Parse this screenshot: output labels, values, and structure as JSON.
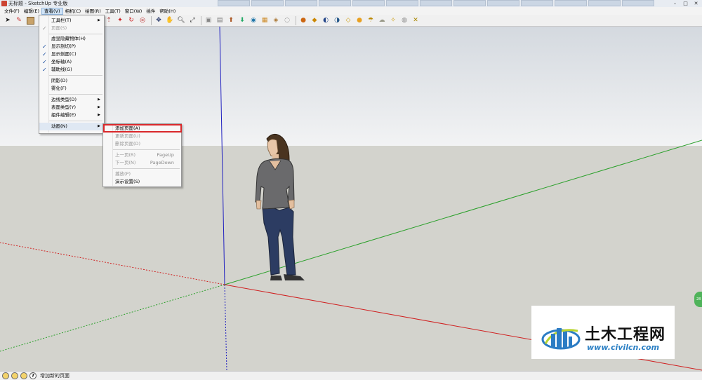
{
  "window": {
    "title": "无标题 - SketchUp 专业版"
  },
  "menubar": {
    "items": [
      {
        "label": "文件(F)"
      },
      {
        "label": "编辑(E)"
      },
      {
        "label": "查看(V)"
      },
      {
        "label": "相机(C)"
      },
      {
        "label": "绘图(R)"
      },
      {
        "label": "工具(T)"
      },
      {
        "label": "窗口(W)"
      },
      {
        "label": "插件"
      },
      {
        "label": "帮助(H)"
      }
    ]
  },
  "view_menu": {
    "items": [
      {
        "label": "工具栏(T)",
        "submenu": true
      },
      {
        "label": "页面(S)",
        "checked": true,
        "disabled": true
      },
      {
        "label": "虚显隐藏物体(H)"
      },
      {
        "label": "显示剖切(P)",
        "checked": true
      },
      {
        "label": "显示剖面(C)",
        "checked": true
      },
      {
        "label": "坐标轴(A)",
        "checked": true
      },
      {
        "label": "辅助线(G)",
        "checked": true
      },
      {
        "label": "阴影(D)"
      },
      {
        "label": "雾化(F)"
      },
      {
        "label": "边线类型(D)",
        "submenu": true
      },
      {
        "label": "表面类型(Y)",
        "submenu": true
      },
      {
        "label": "组件编辑(E)",
        "submenu": true
      },
      {
        "label": "动画(N)",
        "submenu": true
      }
    ]
  },
  "animation_menu": {
    "items": [
      {
        "label": "添加页面(A)"
      },
      {
        "label": "更新页面(U)",
        "disabled": true
      },
      {
        "label": "删除页面(D)",
        "disabled": true
      },
      {
        "label": "上一页(R)",
        "shortcut": "PageUp",
        "disabled": true
      },
      {
        "label": "下一页(N)",
        "shortcut": "PageDown",
        "disabled": true
      },
      {
        "label": "播放(P)",
        "disabled": true
      },
      {
        "label": "演示设置(S)"
      }
    ]
  },
  "status_bar": {
    "text": "增加新的页面"
  },
  "watermark": {
    "title": "土木工程网",
    "url": "www.civilcn.com"
  },
  "colors": {
    "sky_top": "#d4d9df",
    "sky_bottom": "#f2f3f4",
    "ground": "#d3d3cd",
    "highlight": "#d9282b",
    "axis_red": "#d02020",
    "axis_green": "#2aa02a",
    "axis_blue": "#2020c0"
  }
}
